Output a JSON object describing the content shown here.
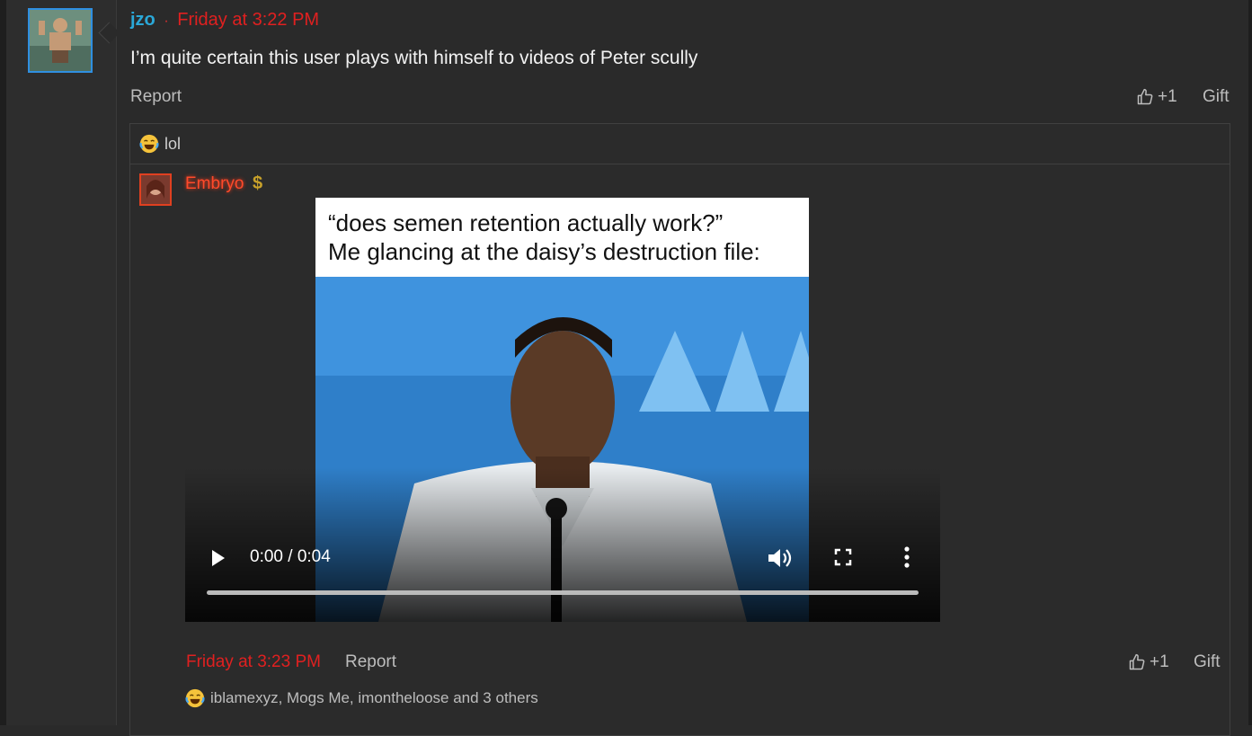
{
  "post": {
    "username": "jzo",
    "separator": "·",
    "timestamp": "Friday at 3:22 PM",
    "text": "I’m quite certain this user plays with himself to videos of Peter scully",
    "report_label": "Report",
    "like_count": "+1",
    "gift_label": "Gift"
  },
  "quote": {
    "reaction_icon": "laughing-crying-emoji-icon",
    "title": "lol",
    "author": "Embryo",
    "author_badge": "$",
    "meme_caption_line1": "“does semen retention actually work?”",
    "meme_caption_line2": "Me glancing at the daisy’s destruction file:",
    "video_time": "0:00 / 0:04",
    "timestamp": "Friday at 3:23 PM",
    "report_label": "Report",
    "like_count": "+1",
    "gift_label": "Gift",
    "reactions_text": "iblamexyz, Mogs Me, imontheloose and 3 others"
  },
  "colors": {
    "username": "#2aa8d8",
    "timestamp": "#e02020",
    "sub_author": "#ff4a2a",
    "avatar_border": "#2f8fe0"
  }
}
